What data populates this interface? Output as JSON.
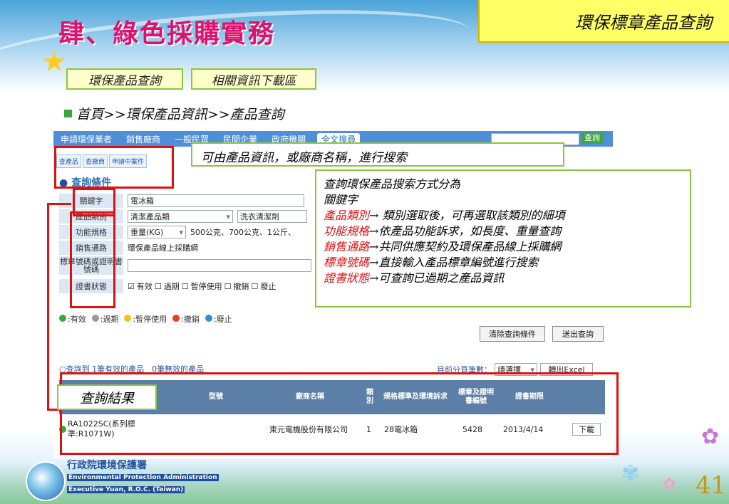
{
  "slide": {
    "main_title": "肆、綠色採購實務",
    "top_right_title": "環保標章產品查詢",
    "nav_buttons": [
      "環保產品查詢",
      "相關資訊下載區"
    ],
    "breadcrumb": "首頁>>環保產品資訊>>產品查詢",
    "page_number": "41"
  },
  "site_menu": {
    "items": [
      "申請環保業者",
      "銷售廠商",
      "一般民眾",
      "民間企業",
      "政府機關"
    ],
    "fulltext_label": "全文搜尋",
    "search_button": "查詢"
  },
  "tabs": [
    "查產品",
    "查廠商",
    "申請中案件"
  ],
  "query": {
    "heading": "查詢條件",
    "rows": [
      {
        "label": "關鍵字",
        "value": "電冰箱"
      },
      {
        "label": "產品類別",
        "value": "清潔產品類",
        "value2": "洗衣清潔劑"
      },
      {
        "label": "功能規格",
        "value": "重量(KG)",
        "value2": "500公克、700公克、1公斤、"
      },
      {
        "label": "銷售通路",
        "value": "環保產品線上採購網"
      },
      {
        "label": "標章號碼或證明書號碼",
        "value": ""
      },
      {
        "label": "證書狀態",
        "checks": [
          "有效",
          "過期",
          "暫停使用",
          "撤銷",
          "廢止"
        ]
      }
    ],
    "legend": [
      {
        "label": "有效",
        "color": "#3da640"
      },
      {
        "label": "過期",
        "color": "#999999"
      },
      {
        "label": "暫停使用",
        "color": "#f0c419"
      },
      {
        "label": "撤銷",
        "color": "#e8401c"
      },
      {
        "label": "廢止",
        "color": "#2a8fd8"
      }
    ],
    "clear_button": "清除查詢條件",
    "submit_button": "送出查詢"
  },
  "results": {
    "summary": "查詢到 1筆有效的產品　0筆無效的產品",
    "pager_label": "目前分頁筆數：",
    "pager_value": "請選擇",
    "excel_button": "轉出Excel",
    "columns": [
      "型號",
      "廠商名稱",
      "類別",
      "規格標準及環境訴求",
      "標章及證明書編號",
      "證書期限"
    ],
    "row": {
      "model": "RA1022SC(系列標準:R1071W)",
      "company": "東元電機股份有限公司",
      "category": "1",
      "spec": "28電冰箱",
      "cert_no": "5428",
      "expiry": "2013/4/14",
      "download": "下載"
    }
  },
  "callouts": {
    "search_tip": "可由產品資訊，或廠商名稱，進行搜索",
    "methods_title": "查詢環保產品搜索方式分為",
    "methods_keyword": "關鍵字",
    "methods": [
      {
        "term": "產品類別",
        "desc": "→ 類別選取後，可再選取該類別的細項"
      },
      {
        "term": "功能規格",
        "desc": "→依產品功能訴求，如長度、重量查詢"
      },
      {
        "term": "銷售通路",
        "desc": "→共同供應契約及環保產品線上採購網"
      },
      {
        "term": "標章號碼",
        "desc": "→直接輸入產品標章編號進行搜索"
      },
      {
        "term": "證書狀態",
        "desc": "→可查詢已過期之產品資訊"
      }
    ],
    "result_label": "查詢結果"
  },
  "footer": {
    "org_zh": "行政院環境保護署",
    "org_en1": "Environmental Protection Administration",
    "org_en2": "Executive Yuan, R.O.C. (Taiwan)"
  }
}
